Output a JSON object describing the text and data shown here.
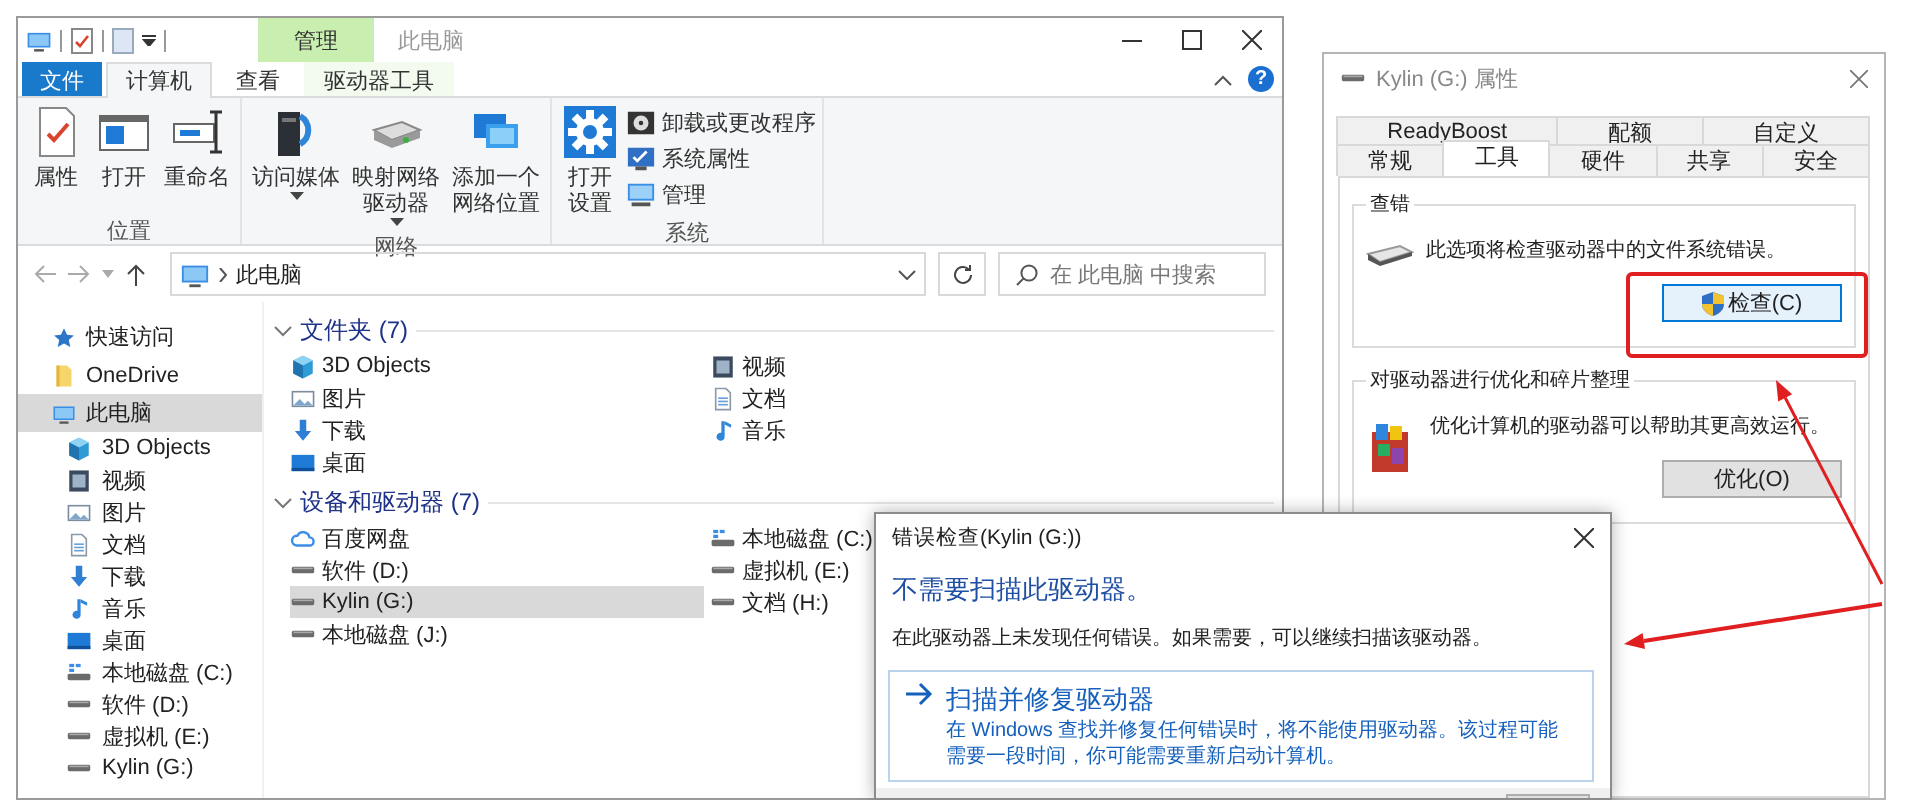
{
  "explorer": {
    "title": "此电脑",
    "context_tab": "管理",
    "ribbon_tabs": [
      {
        "label": "文件",
        "kind": "file",
        "selected": false
      },
      {
        "label": "计算机",
        "kind": "normal",
        "selected": true
      },
      {
        "label": "查看",
        "kind": "normal",
        "selected": false
      },
      {
        "label": "驱动器工具",
        "kind": "context",
        "selected": false
      }
    ],
    "help": "?",
    "ribbon_groups": [
      {
        "label": "位置",
        "commands": [
          {
            "label": "属性",
            "kind": "properties",
            "dropdown": false
          },
          {
            "label": "打开",
            "kind": "open",
            "dropdown": false
          },
          {
            "label": "重命名",
            "kind": "rename",
            "dropdown": false
          }
        ]
      },
      {
        "label": "网络",
        "commands": [
          {
            "label": "访问媒体",
            "kind": "media",
            "dropdown": true
          },
          {
            "label_lines": [
              "映射网络",
              "驱动器"
            ],
            "kind": "mapdrive",
            "dropdown": true
          },
          {
            "label_lines": [
              "添加一个",
              "网络位置"
            ],
            "kind": "netlocation",
            "dropdown": false
          }
        ]
      },
      {
        "label": "系统",
        "commands": [
          {
            "label_lines": [
              "打开",
              "设置"
            ],
            "kind": "settings",
            "dropdown": false
          }
        ],
        "side_commands": [
          {
            "label": "卸载或更改程序",
            "kind": "uninstall"
          },
          {
            "label": "系统属性",
            "kind": "sysprops"
          },
          {
            "label": "管理",
            "kind": "manage"
          }
        ]
      }
    ],
    "address": {
      "path": "此电脑",
      "search_placeholder": "在 此电脑 中搜索"
    },
    "nav": [
      {
        "label": "快速访问",
        "kind": "favorites",
        "selected": false
      },
      {
        "label": "OneDrive",
        "kind": "onedrive",
        "selected": false
      },
      {
        "label": "此电脑",
        "kind": "pc",
        "selected": true,
        "children": [
          {
            "label": "3D Objects",
            "kind": "objects",
            "selected": false
          },
          {
            "label": "视频",
            "kind": "videos",
            "selected": false
          },
          {
            "label": "图片",
            "kind": "pictures",
            "selected": false
          },
          {
            "label": "文档",
            "kind": "documents",
            "selected": false
          },
          {
            "label": "下载",
            "kind": "downloads",
            "selected": false
          },
          {
            "label": "音乐",
            "kind": "music",
            "selected": false
          },
          {
            "label": "桌面",
            "kind": "desktop",
            "selected": false
          },
          {
            "label": "本地磁盘 (C:)",
            "kind": "systemdrive",
            "selected": false
          },
          {
            "label": "软件 (D:)",
            "kind": "drive",
            "selected": false
          },
          {
            "label": "虚拟机 (E:)",
            "kind": "drive",
            "selected": false
          },
          {
            "label": "Kylin (G:)",
            "kind": "drive",
            "selected": false
          }
        ]
      }
    ],
    "sections": [
      {
        "title": "文件夹 (7)",
        "expanded": true,
        "items": [
          {
            "label": "3D Objects",
            "kind": "objects",
            "selected": false
          },
          {
            "label": "图片",
            "kind": "pictures",
            "selected": false
          },
          {
            "label": "下载",
            "kind": "downloads",
            "selected": false
          },
          {
            "label": "桌面",
            "kind": "desktop",
            "selected": false
          },
          {
            "label": "视频",
            "kind": "videos",
            "selected": false
          },
          {
            "label": "文档",
            "kind": "documents",
            "selected": false
          },
          {
            "label": "音乐",
            "kind": "music",
            "selected": false
          }
        ]
      },
      {
        "title": "设备和驱动器 (7)",
        "expanded": true,
        "items": [
          {
            "label": "百度网盘",
            "kind": "clouddrive",
            "selected": false
          },
          {
            "label": "软件 (D:)",
            "kind": "drive",
            "selected": false
          },
          {
            "label": "Kylin (G:)",
            "kind": "drive",
            "selected": true
          },
          {
            "label": "本地磁盘 (J:)",
            "kind": "drive",
            "selected": false
          },
          {
            "label": "本地磁盘 (C:)",
            "kind": "systemdrive",
            "selected": false
          },
          {
            "label": "虚拟机 (E:)",
            "kind": "drive",
            "selected": false
          },
          {
            "label": "文档 (H:)",
            "kind": "drive",
            "selected": false
          }
        ]
      }
    ]
  },
  "properties_dialog": {
    "title": "Kylin (G:) 属性",
    "tab_rows": [
      [
        {
          "label": "ReadyBoost",
          "selected": false
        },
        {
          "label": "配额",
          "selected": false
        },
        {
          "label": "自定义",
          "selected": false
        }
      ],
      [
        {
          "label": "常规",
          "selected": false
        },
        {
          "label": "工具",
          "selected": true
        },
        {
          "label": "硬件",
          "selected": false
        },
        {
          "label": "共享",
          "selected": false
        },
        {
          "label": "安全",
          "selected": false
        }
      ]
    ],
    "groups": [
      {
        "title": "查错",
        "kind": "drive",
        "text": "此选项将检查驱动器中的文件系统错误。",
        "button": {
          "label": "检查(C)",
          "shield": true,
          "focused": true
        }
      },
      {
        "title": "对驱动器进行优化和碎片整理",
        "kind": "defrag",
        "text": "优化计算机的驱动器可以帮助其更高效运行。",
        "button": {
          "label": "优化(O)",
          "shield": false,
          "focused": false
        }
      }
    ]
  },
  "error_dialog": {
    "title": "错误检查(Kylin (G:))",
    "heading": "不需要扫描此驱动器。",
    "message": "在此驱动器上未发现任何错误。如果需要，可以继续扫描该驱动器。",
    "command": {
      "title": "扫描并修复驱动器",
      "description": "在 Windows 查找并修复任何错误时，将不能使用驱动器。该过程可能需要一段时间，你可能需要重新启动计算机。"
    }
  }
}
